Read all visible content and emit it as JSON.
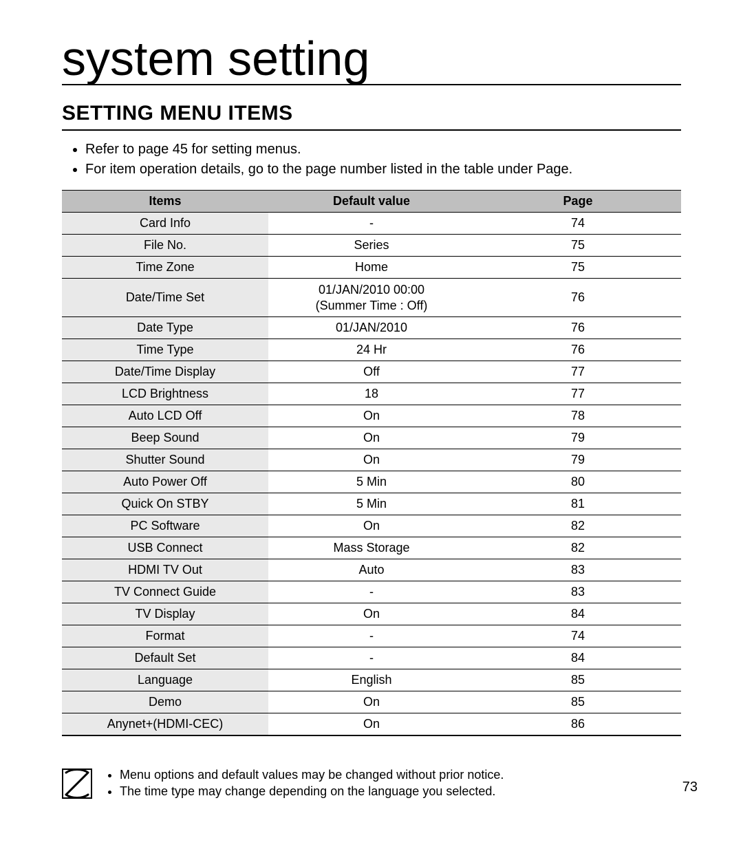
{
  "title": "system setting",
  "section_heading": "SETTING MENU ITEMS",
  "intro_bullets": [
    "Refer to page 45 for setting menus.",
    "For item operation details, go to the page number listed in the table under Page."
  ],
  "table": {
    "headers": {
      "items": "Items",
      "default_value": "Default value",
      "page": "Page"
    },
    "rows": [
      {
        "item": "Card Info",
        "default": "-",
        "page": "74"
      },
      {
        "item": "File No.",
        "default": "Series",
        "page": "75"
      },
      {
        "item": "Time Zone",
        "default": "Home",
        "page": "75"
      },
      {
        "item": "Date/Time Set",
        "default": "01/JAN/2010 00:00\n(Summer Time : Off)",
        "page": "76"
      },
      {
        "item": "Date Type",
        "default": "01/JAN/2010",
        "page": "76"
      },
      {
        "item": "Time Type",
        "default": "24 Hr",
        "page": "76"
      },
      {
        "item": "Date/Time Display",
        "default": "Off",
        "page": "77"
      },
      {
        "item": "LCD Brightness",
        "default": "18",
        "page": "77"
      },
      {
        "item": "Auto LCD Off",
        "default": "On",
        "page": "78"
      },
      {
        "item": "Beep Sound",
        "default": "On",
        "page": "79"
      },
      {
        "item": "Shutter Sound",
        "default": "On",
        "page": "79"
      },
      {
        "item": "Auto Power Off",
        "default": "5 Min",
        "page": "80"
      },
      {
        "item": "Quick On STBY",
        "default": "5 Min",
        "page": "81"
      },
      {
        "item": "PC Software",
        "default": "On",
        "page": "82"
      },
      {
        "item": "USB Connect",
        "default": "Mass Storage",
        "page": "82"
      },
      {
        "item": "HDMI TV Out",
        "default": "Auto",
        "page": "83"
      },
      {
        "item": "TV Connect Guide",
        "default": "-",
        "page": "83"
      },
      {
        "item": "TV Display",
        "default": "On",
        "page": "84"
      },
      {
        "item": "Format",
        "default": "-",
        "page": "74"
      },
      {
        "item": "Default Set",
        "default": "-",
        "page": "84"
      },
      {
        "item": "Language",
        "default": "English",
        "page": "85"
      },
      {
        "item": "Demo",
        "default": "On",
        "page": "85"
      },
      {
        "item": "Anynet+(HDMI-CEC)",
        "default": "On",
        "page": "86"
      }
    ]
  },
  "footer_notes": [
    "Menu options and default values may be changed without prior notice.",
    "The time type may change depending on the language you selected."
  ],
  "page_number": "73"
}
